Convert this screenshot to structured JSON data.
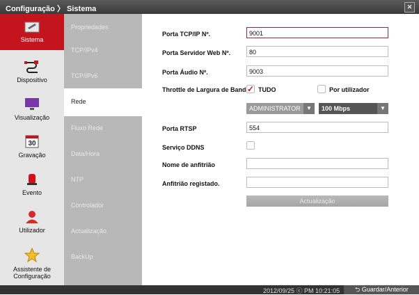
{
  "title": {
    "section": "Configuração",
    "separator": "〉",
    "page": "Sistema"
  },
  "nav": [
    {
      "label": "Sistema",
      "icon": "toolbox-icon"
    },
    {
      "label": "Dispositivo",
      "icon": "cable-icon"
    },
    {
      "label": "Visualização",
      "icon": "monitor-icon"
    },
    {
      "label": "Gravação",
      "icon": "calendar-icon"
    },
    {
      "label": "Evento",
      "icon": "siren-icon"
    },
    {
      "label": "Utilizador",
      "icon": "user-icon"
    },
    {
      "label_line1": "Assistente de",
      "label_line2": "Configuração",
      "icon": "star-icon"
    }
  ],
  "submenu": [
    "Propriedades",
    "TCP/IPv4",
    "TCP/IPv6",
    "Rede",
    "Fluxo Rede",
    "Data/Hora",
    "NTP",
    "Controlador",
    "Actualização",
    "BackUp"
  ],
  "form": {
    "tcp_port_label": "Porta TCP/IP Nº.",
    "tcp_port_value": "9001",
    "web_port_label": "Porta Servidor Web Nº.",
    "web_port_value": "80",
    "audio_port_label": "Porta Áudio Nº.",
    "audio_port_value": "9003",
    "throttle_label": "Throttle de Largura de Banda",
    "throttle_all": "TUDO",
    "throttle_all_checked": true,
    "throttle_per_user": "Por utilizador",
    "user_select": "ADMINISTRATOR",
    "bandwidth_select": "100 Mbps",
    "rtsp_label": "Porta RTSP",
    "rtsp_value": "554",
    "ddns_label": "Serviço DDNS",
    "hostname_label": "Nome de anfitrião",
    "hostname_value": "",
    "registered_label": "Anfitrião registado.",
    "registered_value": "",
    "update_button": "Actualização"
  },
  "status": {
    "datetime": "2012/09/25 ⓒ PM 10:21:05",
    "save_button": "Guardar/Anterior"
  },
  "colors": {
    "accent": "#c4141d",
    "titlebar": "#4a4a4a",
    "submenu": "#b8b8b8"
  }
}
